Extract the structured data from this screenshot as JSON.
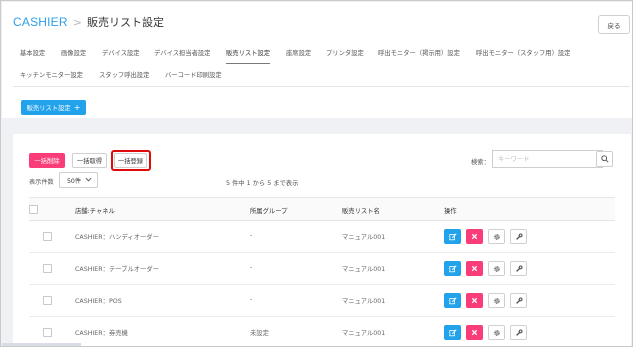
{
  "header": {
    "brand": "CASHIER",
    "separator": ">",
    "title": "販売リスト設定",
    "back_label": "戻る"
  },
  "tabs": [
    {
      "label": "基本設定",
      "active": false
    },
    {
      "label": "画像設定",
      "active": false
    },
    {
      "label": "デバイス設定",
      "active": false
    },
    {
      "label": "デバイス担当者設定",
      "active": false
    },
    {
      "label": "販売リスト設定",
      "active": true
    },
    {
      "label": "座席設定",
      "active": false
    },
    {
      "label": "プリンタ設定",
      "active": false
    },
    {
      "label": "呼出モニター（掲示用）設定",
      "active": false
    },
    {
      "label": "呼出モニター（スタッフ用）設定",
      "active": false
    },
    {
      "label": "キッチンモニター設定",
      "active": false
    },
    {
      "label": "スタッフ呼出設定",
      "active": false
    },
    {
      "label": "バーコード印刷設定",
      "active": false
    }
  ],
  "list_settings_button": {
    "label": "販売リスト設定",
    "icon": "plus-icon"
  },
  "toolbar": {
    "bulk_delete": "一括削除",
    "bulk_fetch": "一括取得",
    "bulk_register": "一括登録",
    "search_label": "検索：",
    "search_placeholder": "キーワード",
    "search_value": ""
  },
  "page_size": {
    "label": "表示件数",
    "value": "50件"
  },
  "paging_info": "5 件中 1 から 5 まで表示",
  "table": {
    "columns": [
      "店舗:チャネル",
      "所属グループ",
      "販売リスト名",
      "操作"
    ],
    "rows": [
      {
        "store": "CASHIER：ハンディオーダー",
        "group": "-",
        "list": "マニュアル001"
      },
      {
        "store": "CASHIER：テーブルオーダー",
        "group": "-",
        "list": "マニュアル001"
      },
      {
        "store": "CASHIER：POS",
        "group": "-",
        "list": "マニュアル001"
      },
      {
        "store": "CASHIER：券売機",
        "group": "未設定",
        "list": "マニュアル001"
      }
    ]
  },
  "colors": {
    "accent": "#23a2ec",
    "danger": "#fa3d78",
    "highlight": "#e00a0a"
  }
}
